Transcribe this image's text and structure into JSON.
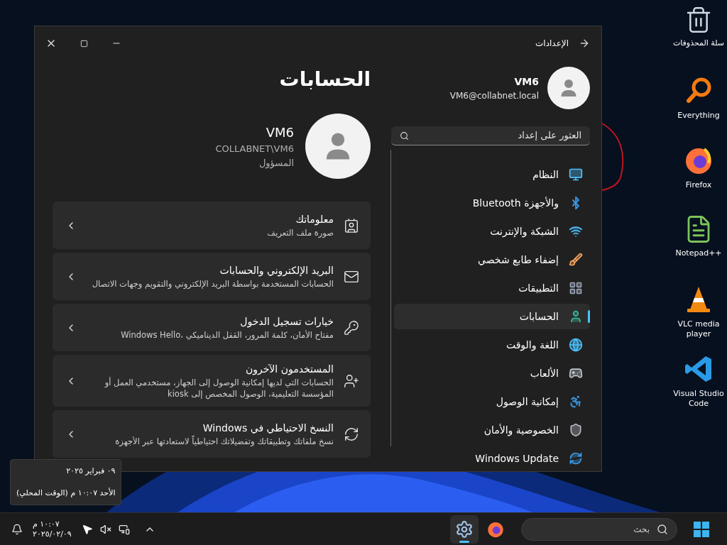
{
  "window": {
    "title": "الإعدادات"
  },
  "user": {
    "name": "VM6",
    "email": "VM6@collabnet.local"
  },
  "search": {
    "placeholder": "العثور على إعداد"
  },
  "nav": [
    {
      "label": "النظام",
      "kind": "system",
      "selected": false
    },
    {
      "label": "والأجهزة Bluetooth",
      "kind": "bluetooth",
      "selected": false
    },
    {
      "label": "الشبكة والإنترنت",
      "kind": "network",
      "selected": false
    },
    {
      "label": "إضفاء طابع شخصي",
      "kind": "personalize",
      "selected": false
    },
    {
      "label": "التطبيقات",
      "kind": "apps",
      "selected": false
    },
    {
      "label": "الحسابات",
      "kind": "accounts",
      "selected": true
    },
    {
      "label": "اللغة والوقت",
      "kind": "time",
      "selected": false
    },
    {
      "label": "الألعاب",
      "kind": "gaming",
      "selected": false
    },
    {
      "label": "إمكانية الوصول",
      "kind": "accessibility",
      "selected": false
    },
    {
      "label": "الخصوصية والأمان",
      "kind": "privacy",
      "selected": false
    },
    {
      "label": "Windows Update",
      "kind": "update",
      "selected": false
    }
  ],
  "page": {
    "title": "الحسابات",
    "account": {
      "name": "VM6",
      "domain": "COLLABNET\\VM6",
      "role": "المسؤول"
    },
    "cards": [
      {
        "kind": "info",
        "title": "معلوماتك",
        "description": "صورة ملف التعريف"
      },
      {
        "kind": "mail",
        "title": "البريد الإلكتروني والحسابات",
        "description": "الحسابات المستخدمة بواسطة البريد الإلكتروني والتقويم وجهات الاتصال"
      },
      {
        "kind": "key",
        "title": "خيارات تسجيل الدخول",
        "description": "مفتاح الأمان، كلمة المرور، القفل الديناميكي ،Windows Hello"
      },
      {
        "kind": "users",
        "title": "المستخدمون الآخرون",
        "description": "الحسابات التي لديها إمكانية الوصول إلى الجهاز، مستخدمي العمل أو المؤسسة التعليمية، الوصول المخصص إلى kiosk"
      },
      {
        "kind": "backup",
        "title": "النسخ الاحتياطي في Windows",
        "description": "نسخ ملفاتك وتطبيقاتك وتفضيلاتك احتياطياً لاستعادتها عبر الأجهزة"
      }
    ]
  },
  "desktop_icons": [
    {
      "kind": "recycle",
      "label": "سلة المحذوفات"
    },
    {
      "kind": "everything",
      "label": "Everything"
    },
    {
      "kind": "firefox",
      "label": "Firefox"
    },
    {
      "kind": "notepad",
      "label": "Notepad++"
    },
    {
      "kind": "vlc",
      "label": "VLC media player"
    },
    {
      "kind": "vscode",
      "label": "Visual Studio Code"
    }
  ],
  "tooltip": {
    "lines": [
      "٠٩ فبراير ٢٠٢٥",
      "الأحد ١٠:٠٧ م (الوقت المحلي)"
    ]
  },
  "taskbar": {
    "clock": {
      "time": "١٠:٠٧ م",
      "date": "٢٠٢٥/٠٢/٠٩"
    },
    "search": {
      "placeholder": "بحث"
    },
    "apps": [
      {
        "kind": "settings",
        "active": true
      },
      {
        "kind": "firefox",
        "active": false
      }
    ]
  }
}
